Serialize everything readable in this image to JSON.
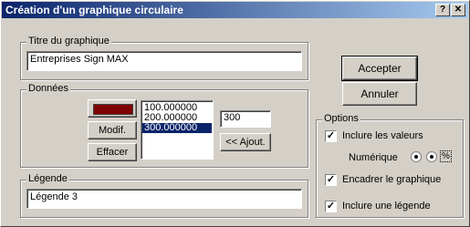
{
  "window": {
    "title": "Création d'un graphique circulaire",
    "help_glyph": "?",
    "close_glyph": "✕"
  },
  "titre": {
    "group_label": "Titre du graphique",
    "value": "Entreprises Sign MAX"
  },
  "donnees": {
    "group_label": "Données",
    "color_swatch": "#800000",
    "modif_label": "Modif.",
    "effacer_label": "Effacer",
    "values": [
      "100.000000",
      "200.000000",
      "300.000000"
    ],
    "selected_index": 2,
    "input_value": "300",
    "ajout_label": "<< Ajout."
  },
  "legende": {
    "group_label": "Légende",
    "value": "Légende 3"
  },
  "buttons": {
    "accepter": "Accepter",
    "annuler": "Annuler"
  },
  "options": {
    "group_label": "Options",
    "inclure_valeurs": "Inclure les valeurs",
    "numerique": "Numérique",
    "percent_glyph": "%",
    "encadrer": "Encadrer le graphique",
    "inclure_legende": "Inclure une légende",
    "checked_mark": "✓"
  }
}
